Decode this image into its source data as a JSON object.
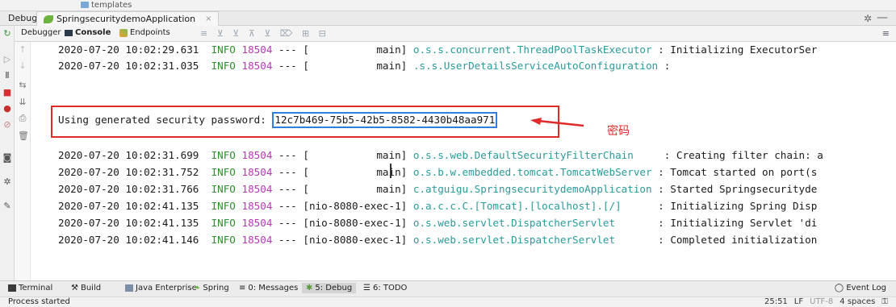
{
  "top_strip": {
    "folder_label": "templates"
  },
  "debug_bar": {
    "label": "Debug:",
    "run_tab": "SpringsecuritydemoApplication",
    "close_glyph": "×",
    "gear_glyph": "✲",
    "minimize_glyph": "—"
  },
  "sub_toolbar": {
    "tabs": [
      "Debugger",
      "Console",
      "Endpoints"
    ],
    "active_tab": "Console",
    "icons": "≡ ⊻ ⊻ ⊼ ⊻ ⌦ ⊞ ⊟"
  },
  "log_lines": [
    {
      "ts": "2020-07-20 10:02:29.631",
      "level": "INFO",
      "pid": "18504",
      "sep": "---",
      "thread": "[           main]",
      "logger": "o.s.s.concurrent.ThreadPoolTaskExecutor",
      "msg": " : Initializing ExecutorSer"
    },
    {
      "ts": "2020-07-20 10:02:31.035",
      "level": "INFO",
      "pid": "18504",
      "sep": "---",
      "thread": "[           main]",
      "logger": ".s.s.UserDetailsServiceAutoConfiguration",
      "msg": " :"
    },
    {
      "ts": "2020-07-20 10:02:31.699",
      "level": "INFO",
      "pid": "18504",
      "sep": "---",
      "thread": "[           main]",
      "logger": "o.s.s.web.DefaultSecurityFilterChain",
      "msg": "     : Creating filter chain: a"
    },
    {
      "ts": "2020-07-20 10:02:31.752",
      "level": "INFO",
      "pid": "18504",
      "sep": "---",
      "thread": "[           main]",
      "logger": "o.s.b.w.embedded.tomcat.TomcatWebServer",
      "msg": " : Tomcat started on port(s"
    },
    {
      "ts": "2020-07-20 10:02:31.766",
      "level": "INFO",
      "pid": "18504",
      "sep": "---",
      "thread": "[           main]",
      "logger": "c.atguigu.SpringsecuritydemoApplication",
      "msg": " : Started Springsecurityde"
    },
    {
      "ts": "2020-07-20 10:02:41.135",
      "level": "INFO",
      "pid": "18504",
      "sep": "---",
      "thread": "[nio-8080-exec-1]",
      "logger": "o.a.c.c.C.[Tomcat].[localhost].[/]",
      "msg": "      : Initializing Spring Disp"
    },
    {
      "ts": "2020-07-20 10:02:41.135",
      "level": "INFO",
      "pid": "18504",
      "sep": "---",
      "thread": "[nio-8080-exec-1]",
      "logger": "o.s.web.servlet.DispatcherServlet",
      "msg": "       : Initializing Servlet 'di"
    },
    {
      "ts": "2020-07-20 10:02:41.146",
      "level": "INFO",
      "pid": "18504",
      "sep": "---",
      "thread": "[nio-8080-exec-1]",
      "logger": "o.s.web.servlet.DispatcherServlet",
      "msg": "       : Completed initialization"
    }
  ],
  "password_line": {
    "prefix": "Using generated security password: ",
    "value": "12c7b469-75b5-42b5-8582-4430b48aa971",
    "annotation": "密码"
  },
  "bottom_bar": {
    "tabs": [
      "Terminal",
      "Build",
      "Java Enterprise",
      "Spring",
      "0: Messages",
      "5: Debug",
      "6: TODO"
    ],
    "active_tab": "5: Debug",
    "event_log": "Event Log"
  },
  "status_bar": {
    "left": "Process started",
    "position": "25:51",
    "line_sep": "LF",
    "encoding": "UTF-8",
    "indent": "4 spaces"
  },
  "colors": {
    "info": "#2f8f2f",
    "pid": "#b43ab4",
    "logger": "#2a9a9a",
    "highlight_red": "#e02b2b",
    "highlight_blue": "#2f7fe0"
  }
}
